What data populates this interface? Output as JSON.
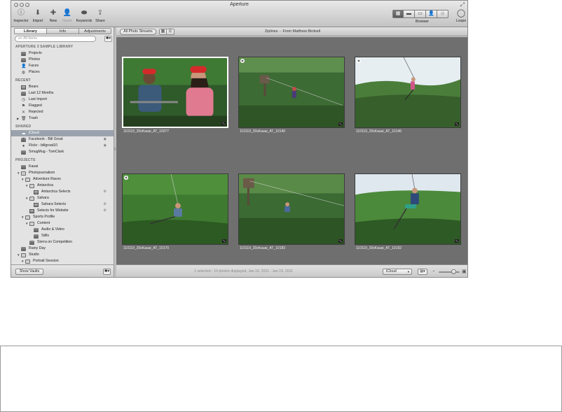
{
  "window": {
    "title": "Aperture"
  },
  "toolbar": {
    "buttons": [
      {
        "label": "Inspector",
        "icon": "info-icon",
        "glyph": "ⓘ"
      },
      {
        "label": "Import",
        "icon": "import-arrow-icon",
        "glyph": "⬇"
      },
      {
        "label": "New",
        "icon": "plus-icon",
        "glyph": "✚"
      },
      {
        "label": "Name",
        "icon": "person-icon",
        "glyph": "👤"
      },
      {
        "label": "Keywords",
        "icon": "tag-icon",
        "glyph": "⬬"
      },
      {
        "label": "Share",
        "icon": "share-icon",
        "glyph": "⇪"
      }
    ],
    "view_modes": [
      "▦",
      "▬",
      "▭",
      "👤",
      "◍"
    ],
    "browser_label": "Browser",
    "loupe_label": "Loupe",
    "loupe_glyph": "◯"
  },
  "sidebar": {
    "tabs": [
      "Library",
      "Info",
      "Adjustments"
    ],
    "search_placeholder": "All Items",
    "action_glyph": "✱▾",
    "library_header": "APERTURE 3 SAMPLE LIBRARY",
    "library_items": [
      {
        "label": "Projects",
        "icon": "projects-icon"
      },
      {
        "label": "Photos",
        "icon": "photos-icon"
      },
      {
        "label": "Faces",
        "icon": "faces-icon"
      },
      {
        "label": "Places",
        "icon": "places-icon"
      }
    ],
    "recent_header": "RECENT",
    "recent_items": [
      {
        "label": "Bears",
        "icon": "album-icon"
      },
      {
        "label": "Last 12 Months",
        "icon": "calendar-icon"
      },
      {
        "label": "Last Import",
        "icon": "clock-icon"
      },
      {
        "label": "Flagged",
        "icon": "flag-icon"
      },
      {
        "label": "Rejected",
        "icon": "reject-x-icon"
      },
      {
        "label": "Trash",
        "icon": "trash-icon"
      }
    ],
    "shared_header": "SHARED",
    "shared_items": [
      {
        "label": "iCloud",
        "icon": "cloud-icon",
        "selected": true,
        "side": ""
      },
      {
        "label": "Facebook - Bill Groat",
        "icon": "facebook-icon",
        "side": "◉"
      },
      {
        "label": "Flickr - billgroat10",
        "icon": "flickr-icon",
        "side": "◉"
      },
      {
        "label": "SmugMug - TomClark",
        "icon": "smugmug-icon",
        "side": ""
      }
    ],
    "projects_header": "PROJECTS",
    "project_items": [
      {
        "label": "Kauai",
        "icon": "project-icon",
        "level": 0,
        "arrow": "",
        "side": ""
      },
      {
        "label": "Photojournalism",
        "icon": "folder-icon",
        "level": 0,
        "arrow": "▼",
        "side": ""
      },
      {
        "label": "Adventure Races",
        "icon": "folder-icon",
        "level": 1,
        "arrow": "▼",
        "side": ""
      },
      {
        "label": "Antarctica",
        "icon": "folder-icon",
        "level": 2,
        "arrow": "▼",
        "side": ""
      },
      {
        "label": "Antarctica Selects",
        "icon": "album-icon",
        "level": 3,
        "arrow": "",
        "side": "⚙"
      },
      {
        "label": "Sahara",
        "icon": "folder-icon",
        "level": 2,
        "arrow": "▼",
        "side": ""
      },
      {
        "label": "Sahara Selects",
        "icon": "album-icon",
        "level": 3,
        "arrow": "",
        "side": "⚙"
      },
      {
        "label": "Selects for Website",
        "icon": "album-icon",
        "level": 2,
        "arrow": "",
        "side": "⚙"
      },
      {
        "label": "Sports Profile",
        "icon": "folder-icon",
        "level": 1,
        "arrow": "▼",
        "side": ""
      },
      {
        "label": "Content",
        "icon": "folder-icon",
        "level": 2,
        "arrow": "▼",
        "side": ""
      },
      {
        "label": "Audio & Video",
        "icon": "project-icon",
        "level": 3,
        "arrow": "",
        "side": ""
      },
      {
        "label": "Stills",
        "icon": "project-icon",
        "level": 3,
        "arrow": "",
        "side": ""
      },
      {
        "label": "Sierra on Competition",
        "icon": "project-icon",
        "level": 2,
        "arrow": "",
        "side": ""
      },
      {
        "label": "Rainy Day",
        "icon": "project-icon",
        "level": 0,
        "arrow": "",
        "side": ""
      },
      {
        "label": "Studio",
        "icon": "folder-icon",
        "level": 0,
        "arrow": "▼",
        "side": ""
      },
      {
        "label": "Portrait Session",
        "icon": "folder-icon",
        "level": 1,
        "arrow": "▼",
        "side": ""
      }
    ],
    "show_vaults_label": "Show Vaults",
    "footer_action_glyph": "✱▾"
  },
  "browser": {
    "all_photo_streams_label": "All Photo Streams",
    "view_buttons": [
      "▦",
      "☰"
    ],
    "breadcrumb": {
      "album": "Ziplines",
      "separator": "–",
      "source": "From Matthew Birdsell"
    },
    "photos": [
      {
        "name": "110119_20sKauai_AT_10077",
        "selected": true,
        "scene": "portrait",
        "badge": ""
      },
      {
        "name": "110119_20sKauai_AT_10140",
        "selected": false,
        "scene": "zipline-far",
        "badge": "◉"
      },
      {
        "name": "110119_20sKauai_AT_10146",
        "selected": false,
        "scene": "zipline-sky",
        "badge": "◉"
      },
      {
        "name": "110119_20sKauai_AT_10170",
        "selected": false,
        "scene": "zipline-near",
        "badge": "◉"
      },
      {
        "name": "110119_20sKauai_AT_10183",
        "selected": false,
        "scene": "zipline-jungle",
        "badge": ""
      },
      {
        "name": "110119_20sKauai_AT_10192",
        "selected": false,
        "scene": "zipline-close",
        "badge": ""
      }
    ],
    "corner_glyph": "⤡",
    "status_text": "1 selected - 10 photos displayed, Jan 19, 2011 - Jan 19, 2011",
    "share_popup_label": "iCloud",
    "share_popup_chevron": "▾",
    "sort_glyph": "▤▾",
    "zoom_small_glyph": "▪",
    "zoom_large_glyph": "▣",
    "zoom_level": 0.72
  }
}
